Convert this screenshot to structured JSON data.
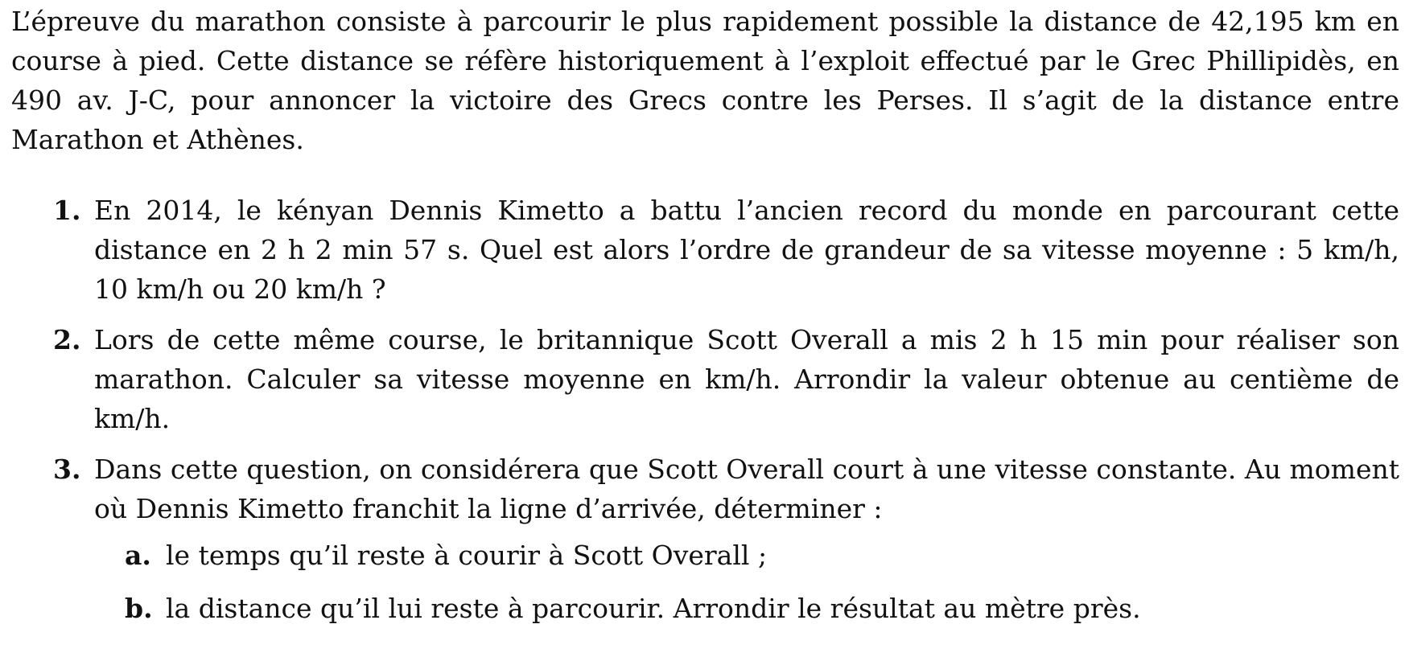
{
  "intro": "L’épreuve du marathon consiste à parcourir le plus rapidement possible la distance de 42,195 km en course à pied. Cette distance se réfère historiquement à l’exploit effectué par le Grec Phillipidès, en 490 av. J-C, pour annoncer la victoire des Grecs contre les Perses. Il s’agit de la distance entre Marathon et Athènes.",
  "questions": [
    {
      "number": "1.",
      "text": "En 2014, le kényan Dennis Kimetto a battu l’ancien record du monde en parcourant cette distance en 2 h 2 min 57 s. Quel est alors l’ordre de grandeur de sa vitesse moyenne : 5 km/h,  10 km/h ou 20 km/h ?"
    },
    {
      "number": "2.",
      "text": "Lors de cette même course, le britannique Scott Overall a mis 2 h 15 min pour réaliser son marathon. Calculer sa vitesse moyenne en km/h. Arrondir la valeur obtenue au centième de km/h."
    },
    {
      "number": "3.",
      "text": "Dans cette question, on considérera que Scott Overall court à une vitesse constante. Au moment où Dennis Kimetto franchit la ligne d’arrivée, déterminer :",
      "subitems": [
        {
          "letter": "a.",
          "text": "le temps qu’il reste à courir à Scott Overall ;"
        },
        {
          "letter": "b.",
          "text": "la distance qu’il lui reste à parcourir. Arrondir le résultat au mètre près."
        }
      ]
    }
  ]
}
